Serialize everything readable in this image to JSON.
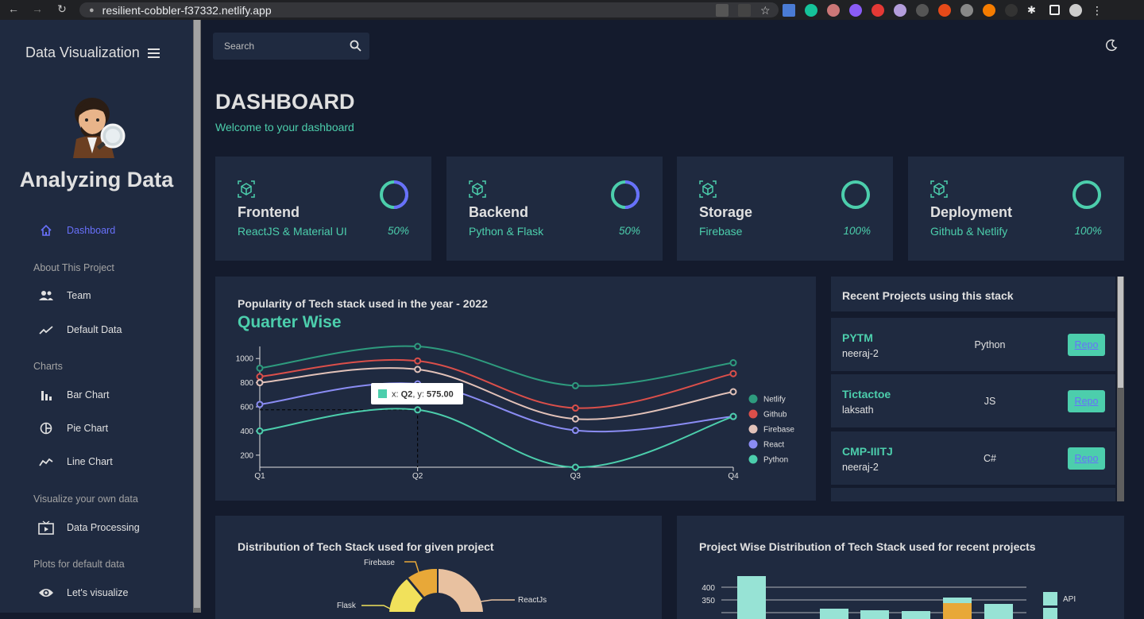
{
  "browser": {
    "url": "resilient-cobbler-f37332.netlify.app"
  },
  "sidebar": {
    "title": "Data Visualization",
    "profile_name": "Analyzing Data",
    "items": [
      {
        "label": "Dashboard",
        "icon": "home-icon",
        "active": true
      },
      {
        "label": "Team",
        "icon": "people-icon"
      },
      {
        "label": "Default Data",
        "icon": "trend-icon"
      },
      {
        "label": "Bar Chart",
        "icon": "bar-chart-icon"
      },
      {
        "label": "Pie Chart",
        "icon": "pie-chart-icon"
      },
      {
        "label": "Line Chart",
        "icon": "line-chart-icon"
      },
      {
        "label": "Data Processing",
        "icon": "tv-icon"
      },
      {
        "label": "Let's visualize",
        "icon": "eye-icon"
      }
    ],
    "sections": [
      "About This Project",
      "Charts",
      "Visualize your own data",
      "Plots for default data"
    ]
  },
  "topbar": {
    "search_placeholder": "Search"
  },
  "header": {
    "title": "DASHBOARD",
    "subtitle": "Welcome to your dashboard"
  },
  "stats": [
    {
      "title": "Frontend",
      "subtitle": "ReactJS & Material UI",
      "percent_label": "50%",
      "progress": 0.5
    },
    {
      "title": "Backend",
      "subtitle": "Python & Flask",
      "percent_label": "50%",
      "progress": 0.5
    },
    {
      "title": "Storage",
      "subtitle": "Firebase",
      "percent_label": "100%",
      "progress": 1.0
    },
    {
      "title": "Deployment",
      "subtitle": "Github & Netlify",
      "percent_label": "100%",
      "progress": 1.0
    }
  ],
  "line_card": {
    "title": "Popularity of Tech stack used in the year - 2022",
    "subtitle": "Quarter Wise"
  },
  "chart_data": [
    {
      "type": "line",
      "categories": [
        "Q1",
        "Q2",
        "Q3",
        "Q4"
      ],
      "ylim": [
        100,
        1100
      ],
      "yticks": [
        200,
        400,
        600,
        800,
        1000
      ],
      "legend_position": "right",
      "series": [
        {
          "name": "Netlify",
          "color": "#2e9b7e",
          "values": [
            920,
            1100,
            775,
            965
          ]
        },
        {
          "name": "Github",
          "color": "#db4f4a",
          "values": [
            850,
            980,
            590,
            875
          ]
        },
        {
          "name": "Firebase",
          "color": "#e2c2b9",
          "values": [
            800,
            910,
            500,
            725
          ]
        },
        {
          "name": "React",
          "color": "#8a8cf3",
          "values": [
            620,
            790,
            405,
            520
          ]
        },
        {
          "name": "Python",
          "color": "#4cceac",
          "values": [
            400,
            575,
            100,
            520
          ]
        }
      ],
      "tooltip": {
        "x_label": "x:",
        "x": "Q2",
        "y_label": "y:",
        "y": "575.00",
        "series": "Python"
      }
    },
    {
      "type": "pie",
      "title": "Distribution of Tech Stack used for given project",
      "labels": [
        "Firebase",
        "Flask",
        "ReactJs"
      ],
      "colors": [
        "#e8a838",
        "#f1e15b",
        "#e8c1a0"
      ]
    },
    {
      "type": "bar",
      "title": "Project Wise Distribution of Tech Stack used for recent projects",
      "yticks": [
        350,
        400
      ],
      "legend": [
        "API"
      ],
      "legend_colors": [
        "#97e3d5"
      ]
    }
  ],
  "projects": {
    "title": "Recent Projects using this stack",
    "repo_label": "Repo",
    "rows": [
      {
        "name": "PYTM",
        "user": "neeraj-2",
        "lang": "Python"
      },
      {
        "name": "Tictactoe",
        "user": "laksath",
        "lang": "JS"
      },
      {
        "name": "CMP-IIITJ",
        "user": "neeraj-2",
        "lang": "C#"
      }
    ]
  },
  "colors": {
    "accent_green": "#4cceac",
    "accent_purple": "#6870fa",
    "card_bg": "#1f2a40",
    "page_bg": "#141b2d"
  }
}
